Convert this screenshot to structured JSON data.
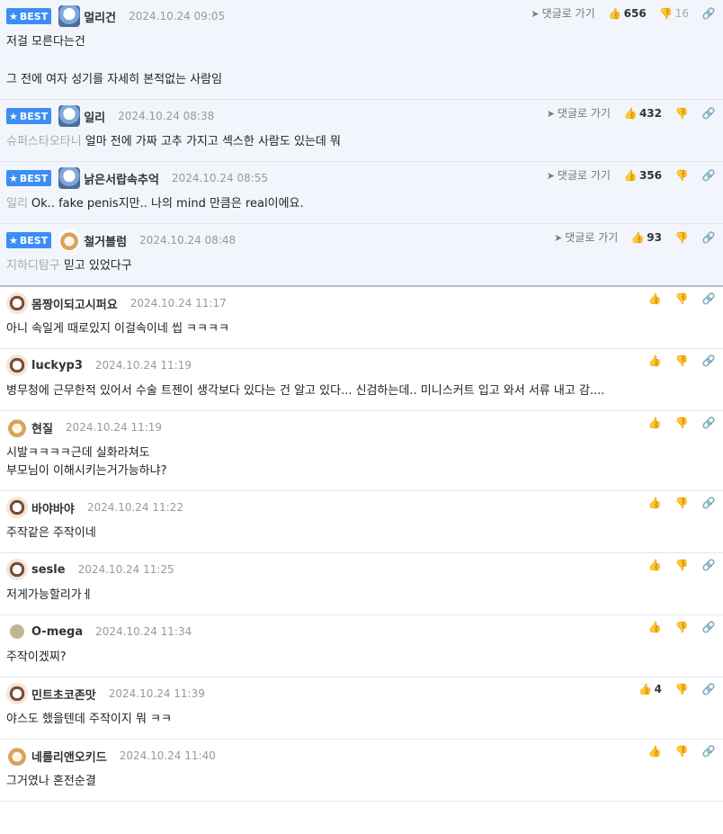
{
  "labels": {
    "best": "BEST",
    "goto": "댓글로 가기"
  },
  "comments": [
    {
      "best": true,
      "avatar": "ghost",
      "nick": "멀리건",
      "date": "2024.10.24 09:05",
      "up": "656",
      "down": "16",
      "lines": [
        "저걸 모른다는건",
        "",
        "그 전에 여자 성기를 자세히 본적없는 사람임"
      ],
      "reply_to": ""
    },
    {
      "best": true,
      "avatar": "ghost",
      "nick": "일리",
      "date": "2024.10.24 08:38",
      "up": "432",
      "down": "",
      "lines": [
        "얼마 전에 가짜 고추 가지고 섹스한 사람도 있는데 뭐"
      ],
      "reply_to": "슈퍼스타오타니"
    },
    {
      "best": true,
      "avatar": "ghost",
      "nick": "낡은서랍속추억",
      "date": "2024.10.24 08:55",
      "up": "356",
      "down": "",
      "lines": [
        "Ok.. fake penis지만.. 나의 mind 만큼은 real이에요."
      ],
      "reply_to": "일리"
    },
    {
      "best": true,
      "avatar": "dog",
      "nick": "철거블럼",
      "date": "2024.10.24 08:48",
      "up": "93",
      "down": "",
      "lines": [
        "믿고 있었다구"
      ],
      "reply_to": "지하디탐구"
    },
    {
      "best": false,
      "avatar": "pup",
      "nick": "몸짱이되고시퍼요",
      "date": "2024.10.24 11:17",
      "up": "",
      "down": "",
      "lines": [
        "아니 속일게 때로있지 이걸속이네 씹 ㅋㅋㅋㅋ"
      ],
      "reply_to": ""
    },
    {
      "best": false,
      "avatar": "pup",
      "nick": "luckyp3",
      "date": "2024.10.24 11:19",
      "up": "",
      "down": "",
      "lines": [
        "병무청에 근무한적 있어서 수술 트젠이 생각보다 있다는 건 알고 있다... 신검하는데.. 미니스커트 입고 와서 서류 내고 감...."
      ],
      "reply_to": ""
    },
    {
      "best": false,
      "avatar": "dog",
      "nick": "현질",
      "date": "2024.10.24 11:19",
      "up": "",
      "down": "",
      "lines": [
        "시발ㅋㅋㅋㅋ근데 실화라쳐도",
        "부모님이 이해시키는거가능하냐?"
      ],
      "reply_to": ""
    },
    {
      "best": false,
      "avatar": "pup",
      "nick": "바야바야",
      "date": "2024.10.24 11:22",
      "up": "",
      "down": "",
      "lines": [
        "주작같은 주작이네"
      ],
      "reply_to": ""
    },
    {
      "best": false,
      "avatar": "pup",
      "nick": "sesle",
      "date": "2024.10.24 11:25",
      "up": "",
      "down": "",
      "lines": [
        "저게가능할리가ㅔ"
      ],
      "reply_to": ""
    },
    {
      "best": false,
      "avatar": "dot",
      "nick": "O-mega",
      "date": "2024.10.24 11:34",
      "up": "",
      "down": "",
      "lines": [
        "주작이겠찌?"
      ],
      "reply_to": ""
    },
    {
      "best": false,
      "avatar": "pup",
      "nick": "민트초코존맛",
      "date": "2024.10.24 11:39",
      "up": "4",
      "down": "",
      "lines": [
        "야스도 했을텐데 주작이지 뭐 ㅋㅋ"
      ],
      "reply_to": ""
    },
    {
      "best": false,
      "avatar": "dog",
      "nick": "네롤리앤오키드",
      "date": "2024.10.24 11:40",
      "up": "",
      "down": "",
      "lines": [
        "그거였나 혼전순결"
      ],
      "reply_to": ""
    }
  ]
}
